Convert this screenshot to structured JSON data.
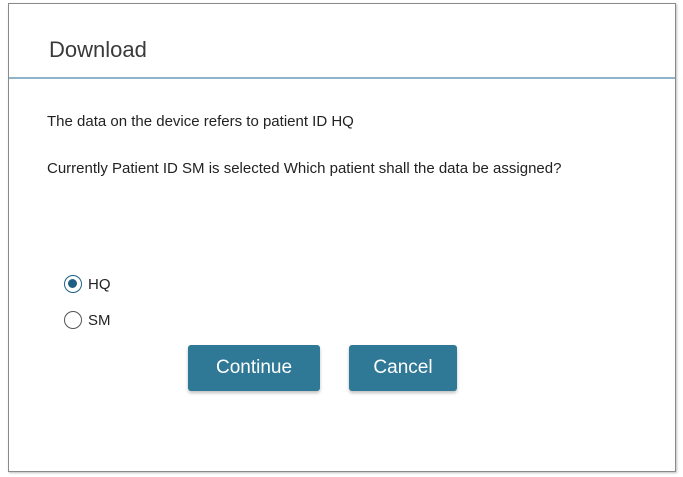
{
  "dialog": {
    "title": "Download",
    "message_line1": "The data on the device refers to patient ID HQ",
    "message_line2": "Currently Patient ID SM is selected Which patient shall the data be assigned?",
    "options": [
      {
        "label": "HQ",
        "selected": true
      },
      {
        "label": "SM",
        "selected": false
      }
    ],
    "continue_label": "Continue",
    "cancel_label": "Cancel"
  },
  "colors": {
    "accent": "#2f7896",
    "header_rule": "#8fb4c9",
    "radio_selected": "#1f5f86"
  }
}
